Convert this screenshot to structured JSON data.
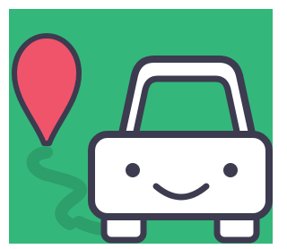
{
  "icon": {
    "name": "car-map-pin-app-icon",
    "colors": {
      "background": "#34b77b",
      "shadow": "#2c9f6a",
      "outline": "#3d3b4f",
      "pin": "#f0546b",
      "car_body": "#ffffff",
      "windshield": "#34b77b"
    },
    "parts": [
      "map-pin-icon",
      "smiling-car-icon",
      "road-trail-shadow"
    ]
  }
}
